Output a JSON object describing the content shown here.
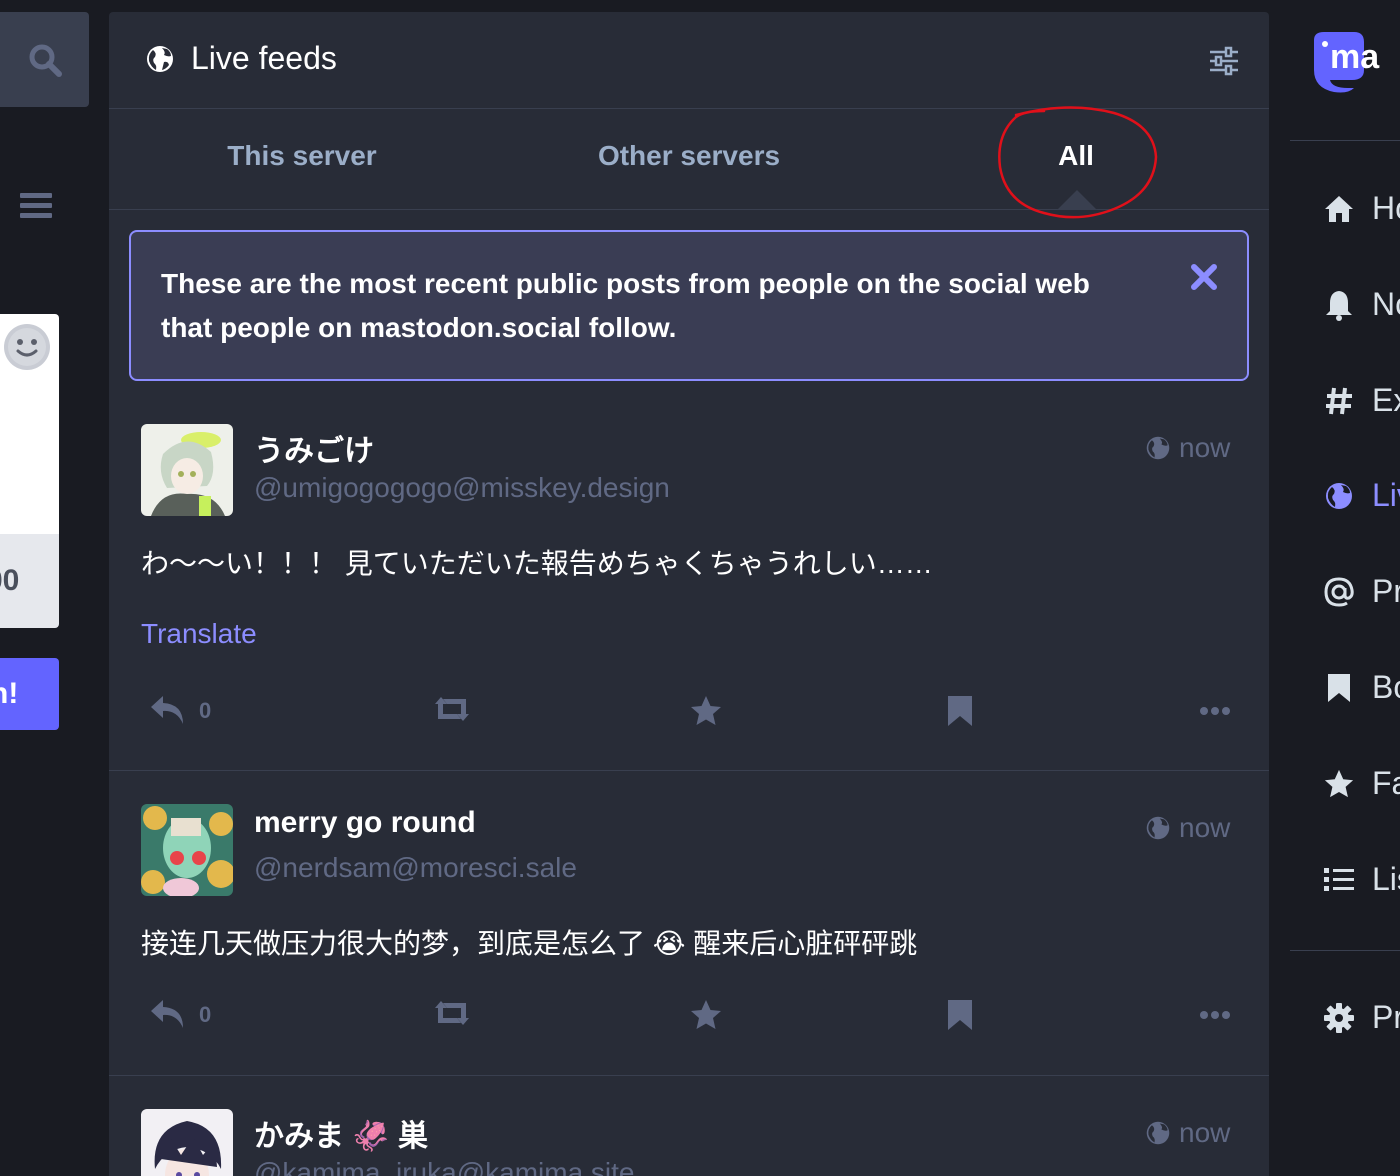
{
  "left": {
    "search_icon": "search-icon",
    "menu_icon": "hamburger-icon",
    "compose_counter": "00",
    "publish_label": "h!"
  },
  "column": {
    "title": "Live feeds",
    "title_icon": "globe-icon",
    "settings_icon": "sliders-icon"
  },
  "tabs": [
    {
      "label": "This server",
      "active": false
    },
    {
      "label": "Other servers",
      "active": false
    },
    {
      "label": "All",
      "active": true
    }
  ],
  "banner": {
    "text": "These are the most recent public posts from people on the social web that people on mastodon.social follow.",
    "close_icon": "close-icon"
  },
  "posts": [
    {
      "display_name": "うみごけ",
      "acct": "@umigogogogo@misskey.design",
      "time": "now",
      "content": "わ～～い！！！ 見ていただいた報告めちゃくちゃうれしい……",
      "translate": "Translate",
      "replies": "0"
    },
    {
      "display_name": "merry go round",
      "acct": "@nerdsam@moresci.sale",
      "time": "now",
      "content": "接连几天做压力很大的梦，到底是怎么了 😭 醒来后心脏砰砰跳",
      "replies": "0"
    },
    {
      "display_name": "かみま 🦑 巣",
      "acct": "@kamima_iruka@kamima.site",
      "time": "now"
    }
  ],
  "nav": {
    "logo_text": "ma",
    "items": [
      {
        "label": "Ho",
        "icon": "home-icon"
      },
      {
        "label": "No",
        "icon": "bell-icon"
      },
      {
        "label": "Ex",
        "icon": "hashtag-icon"
      },
      {
        "label": "Liv",
        "icon": "globe-icon"
      },
      {
        "label": "Pr",
        "icon": "at-icon"
      },
      {
        "label": "Bo",
        "icon": "bookmark-icon"
      },
      {
        "label": "Fa",
        "icon": "star-icon"
      },
      {
        "label": "Lis",
        "icon": "list-icon"
      },
      {
        "label": "Pr",
        "icon": "gear-icon"
      }
    ]
  },
  "colors": {
    "accent": "#8c8dff",
    "background": "#191b22",
    "column": "#282c37",
    "muted": "#606984",
    "annotation": "#e0101a"
  }
}
